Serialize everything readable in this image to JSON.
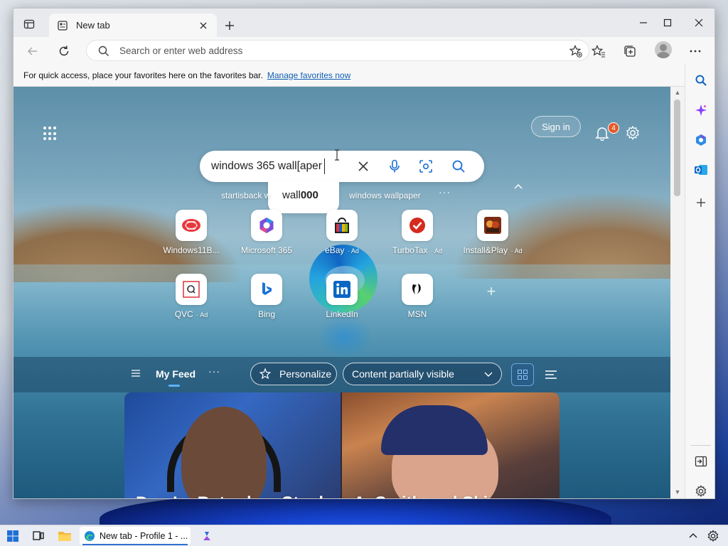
{
  "browser": {
    "tab_title": "New tab",
    "address_placeholder": "Search or enter web address",
    "favorites_bar_text": "For quick access, place your favorites here on the favorites bar.",
    "favorites_bar_link": "Manage favorites now"
  },
  "newtab": {
    "sign_in_label": "Sign in",
    "notification_count": "4",
    "search_value": "windows 365 wall[aper",
    "suggestion": {
      "typed": "wall",
      "bold": "000"
    },
    "trending": [
      "startisback w",
      "windows wallpaper"
    ],
    "quick_links": [
      {
        "label": "Windows11B...",
        "ad": "",
        "icon": "windows11-icon"
      },
      {
        "label": "Microsoft 365",
        "ad": "",
        "icon": "microsoft365-icon"
      },
      {
        "label": "eBay",
        "ad": "Ad",
        "icon": "ebay-icon"
      },
      {
        "label": "TurboTax",
        "ad": "Ad",
        "icon": "turbotax-icon"
      },
      {
        "label": "Install&Play",
        "ad": "Ad",
        "icon": "installplay-icon"
      },
      {
        "label": "QVC",
        "ad": "Ad",
        "icon": "qvc-icon"
      },
      {
        "label": "Bing",
        "ad": "",
        "icon": "bing-icon"
      },
      {
        "label": "LinkedIn",
        "ad": "",
        "icon": "linkedin-icon"
      },
      {
        "label": "MSN",
        "ad": "",
        "icon": "msn-icon"
      }
    ]
  },
  "feed": {
    "title": "My Feed",
    "personalize_label": "Personalize",
    "visibility_label": "Content partially visible",
    "headline": "Dan Le Batard on Stephen A. Smith and Skip"
  },
  "taskbar": {
    "task_label": "New tab - Profile 1 - ..."
  },
  "colors": {
    "accent": "#0f5fb5",
    "badge": "#e25a2a"
  }
}
